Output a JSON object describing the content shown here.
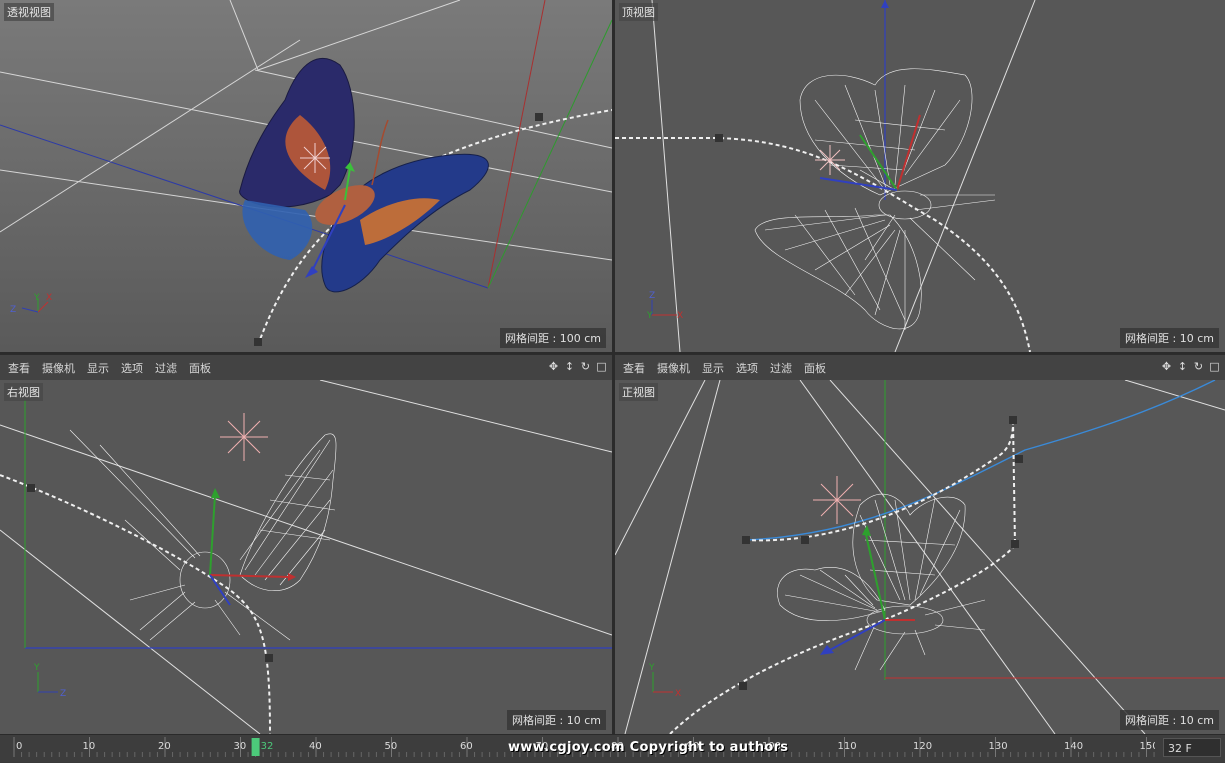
{
  "viewports": {
    "perspective": {
      "label": "透视视图",
      "grid_spacing": "网格间距 : 100 cm"
    },
    "top": {
      "label": "顶视图",
      "grid_spacing": "网格间距 : 10 cm"
    },
    "right": {
      "label": "右视图",
      "grid_spacing": "网格间距 : 10 cm"
    },
    "front": {
      "label": "正视图",
      "grid_spacing": "网格间距 : 10 cm"
    }
  },
  "menu": {
    "items": [
      "查看",
      "摄像机",
      "显示",
      "选项",
      "过滤",
      "面板"
    ]
  },
  "timeline": {
    "ticks": [
      "0",
      "10",
      "20",
      "30",
      "40",
      "50",
      "60",
      "70",
      "80",
      "90",
      "100",
      "110",
      "120",
      "130",
      "140",
      "150"
    ],
    "current_frame": "32",
    "frame_field": "32 F"
  },
  "watermark": "www.cgjoy.com Copyright to authors",
  "axis_labels": {
    "x": "X",
    "y": "Y",
    "z": "Z"
  },
  "colors": {
    "x_axis": "#c03030",
    "y_axis": "#2ea02e",
    "z_axis": "#3040b0",
    "current_frame_marker": "#4cc97a"
  }
}
